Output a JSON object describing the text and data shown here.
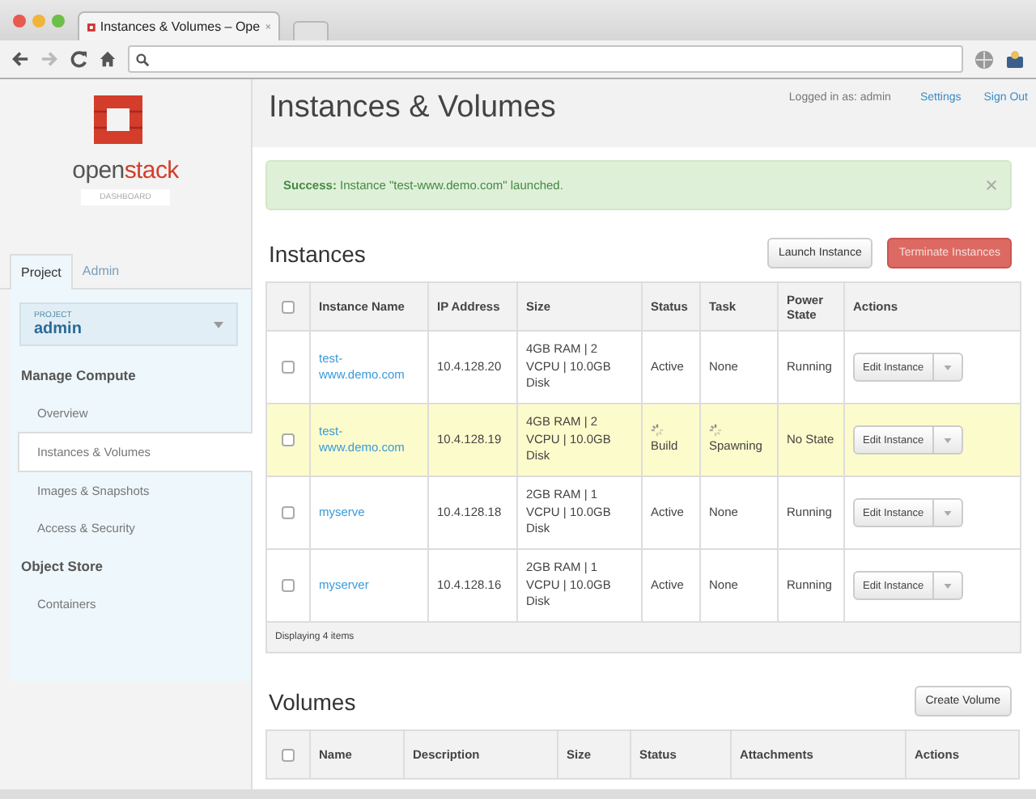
{
  "browser": {
    "tab_title": "Instances & Volumes – Ope"
  },
  "sidebar": {
    "logo": {
      "word_part_1": "open",
      "word_part_2": "stack",
      "subtitle": "DASHBOARD"
    },
    "tabs": [
      {
        "label": "Project",
        "selected": true
      },
      {
        "label": "Admin",
        "selected": false
      }
    ],
    "project_selector": {
      "label": "PROJECT",
      "value": "admin"
    },
    "sections": [
      {
        "heading": "Manage Compute",
        "items": [
          {
            "label": "Overview",
            "selected": false
          },
          {
            "label": "Instances & Volumes",
            "selected": true
          },
          {
            "label": "Images & Snapshots",
            "selected": false
          },
          {
            "label": "Access & Security",
            "selected": false
          }
        ]
      },
      {
        "heading": "Object Store",
        "items": [
          {
            "label": "Containers",
            "selected": false
          }
        ]
      }
    ]
  },
  "header": {
    "title": "Instances & Volumes",
    "user_text": "Logged in as: admin",
    "links": [
      "Settings",
      "Sign Out"
    ]
  },
  "alert": {
    "message": "**Success:** Instance \"test-www.demo.com\" launched."
  },
  "instances": {
    "title": "Instances",
    "buttons": [
      {
        "label": "Launch Instance",
        "kind": "default"
      },
      {
        "label": "Terminate Instances",
        "kind": "danger"
      }
    ],
    "select_all_checked": false,
    "columns": [
      "Instance Name",
      "IP Address",
      "Size",
      "Status",
      "Task",
      "Power State",
      "Actions"
    ],
    "rows": [
      {
        "name": "test-www.demo.com",
        "ip": "10.4.128.20",
        "size": "4GB RAM | 2 VCPU | 10.0GB Disk",
        "status": "Active",
        "task": "None",
        "power_state": "Running",
        "action": "Edit Instance",
        "checked": false,
        "highlighted": false,
        "busy": false
      },
      {
        "name": "test-www.demo.com",
        "ip": "10.4.128.19",
        "size": "4GB RAM | 2 VCPU | 10.0GB Disk",
        "status": "Build",
        "task": "Spawning",
        "power_state": "No State",
        "action": "Edit Instance",
        "checked": false,
        "highlighted": true,
        "busy": true
      },
      {
        "name": "myserve",
        "ip": "10.4.128.18",
        "size": "2GB RAM | 1 VCPU | 10.0GB Disk",
        "status": "Active",
        "task": "None",
        "power_state": "Running",
        "action": "Edit Instance",
        "checked": false,
        "highlighted": false,
        "busy": false
      },
      {
        "name": "myserver",
        "ip": "10.4.128.16",
        "size": "2GB RAM | 1 VCPU | 10.0GB Disk",
        "status": "Active",
        "task": "None",
        "power_state": "Running",
        "action": "Edit Instance",
        "checked": false,
        "highlighted": false,
        "busy": false
      }
    ],
    "footer": "Displaying 4 items"
  },
  "volumes": {
    "title": "Volumes",
    "button": "Create Volume",
    "select_all_checked": false,
    "columns": [
      "Name",
      "Description",
      "Size",
      "Status",
      "Attachments",
      "Actions"
    ]
  }
}
